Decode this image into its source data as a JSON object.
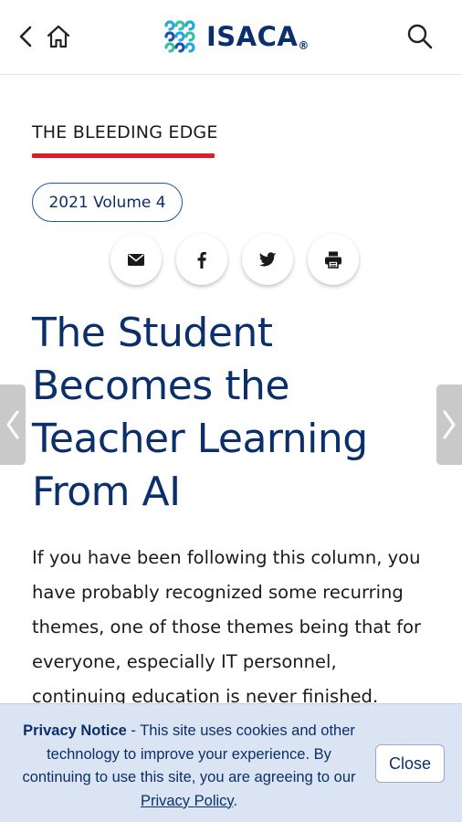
{
  "header": {
    "brand": "ISACA",
    "brand_mark": "®",
    "icons": [
      "chevron-left-icon",
      "home-icon",
      "search-icon"
    ]
  },
  "section": {
    "label": "THE BLEEDING EDGE",
    "accent_color": "#e21b24"
  },
  "volume": {
    "label": "2021 Volume 4"
  },
  "share": {
    "icons": [
      "email-icon",
      "facebook-icon",
      "twitter-icon",
      "print-icon"
    ]
  },
  "article": {
    "title_lines": [
      "The Student",
      "Becomes the",
      "Teacher Learning",
      "From AI"
    ],
    "body_lines": [
      "If you have been following this column, you",
      "have probably recognized some recurring",
      "themes, one of those themes being that for",
      "everyone, especially IT personnel,",
      "continuing education is never finished."
    ],
    "title_color": "#0b2f6b"
  },
  "privacy": {
    "heading": "Privacy Notice",
    "text_1": " - This site uses cookies and other technology to improve your experience. By continuing to use this site, you are agreeing to our ",
    "link": "Privacy Policy",
    "text_2": ".",
    "close_label": "Close",
    "background": "#dbe4f3"
  }
}
